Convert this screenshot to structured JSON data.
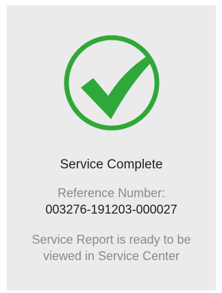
{
  "status": {
    "icon": "checkmark-icon",
    "title": "Service Complete",
    "accent_color": "#2fa83a"
  },
  "reference": {
    "label": "Reference Number:",
    "number": "003276-191203-000027"
  },
  "message": "Service Report is ready to be viewed in Service Center"
}
